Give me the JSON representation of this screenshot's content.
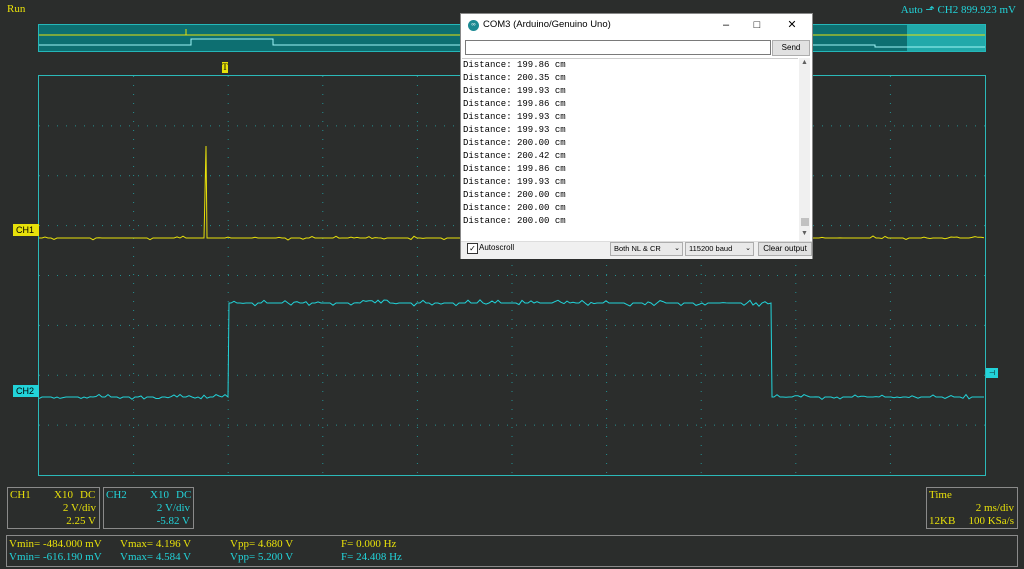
{
  "status": {
    "run": "Run",
    "trigger": "Auto ⬏ CH2 899.923 mV"
  },
  "markers": {
    "ch1": "CH1",
    "ch2": "CH2",
    "trigger": "T",
    "ch2_right": "⊣"
  },
  "serial": {
    "title": "COM3 (Arduino/Genuino Uno)",
    "input_value": "",
    "send_label": "Send",
    "lines": [
      "Distance: 199.86 cm",
      "Distance: 200.35 cm",
      "Distance: 199.93 cm",
      "Distance: 199.86 cm",
      "Distance: 199.93 cm",
      "Distance: 199.93 cm",
      "Distance: 200.00 cm",
      "Distance: 200.42 cm",
      "Distance: 199.86 cm",
      "Distance: 199.93 cm",
      "Distance: 200.00 cm",
      "Distance: 200.00 cm",
      "Distance: 200.00 cm"
    ],
    "autoscroll_label": "Autoscroll",
    "autoscroll_checked": true,
    "line_ending": "Both NL & CR",
    "baud": "115200 baud",
    "clear_label": "Clear output"
  },
  "ch1_panel": {
    "name": "CH1",
    "probe": "X10",
    "coupling": "DC",
    "vdiv": "2 V/div",
    "offset": "2.25 V"
  },
  "ch2_panel": {
    "name": "CH2",
    "probe": "X10",
    "coupling": "DC",
    "vdiv": "2 V/div",
    "offset": "-5.82 V"
  },
  "time_panel": {
    "label": "Time",
    "tdiv": "2 ms/div",
    "mem": "12KB",
    "rate": "100 KSa/s"
  },
  "measurements": {
    "ch1": {
      "vmin": "Vmin= -484.000 mV",
      "vmax": "Vmax= 4.196 V",
      "vpp": "Vpp= 4.680 V",
      "freq": "F= 0.000 Hz"
    },
    "ch2": {
      "vmin": "Vmin= -616.190 mV",
      "vmax": "Vmax= 4.584 V",
      "vpp": "Vpp= 5.200 V",
      "freq": "F= 24.408 Hz"
    }
  },
  "colors": {
    "ch1": "#e8e10a",
    "ch2": "#22d3d9",
    "grid": "#22a9ab",
    "background": "#2b2d2c"
  }
}
